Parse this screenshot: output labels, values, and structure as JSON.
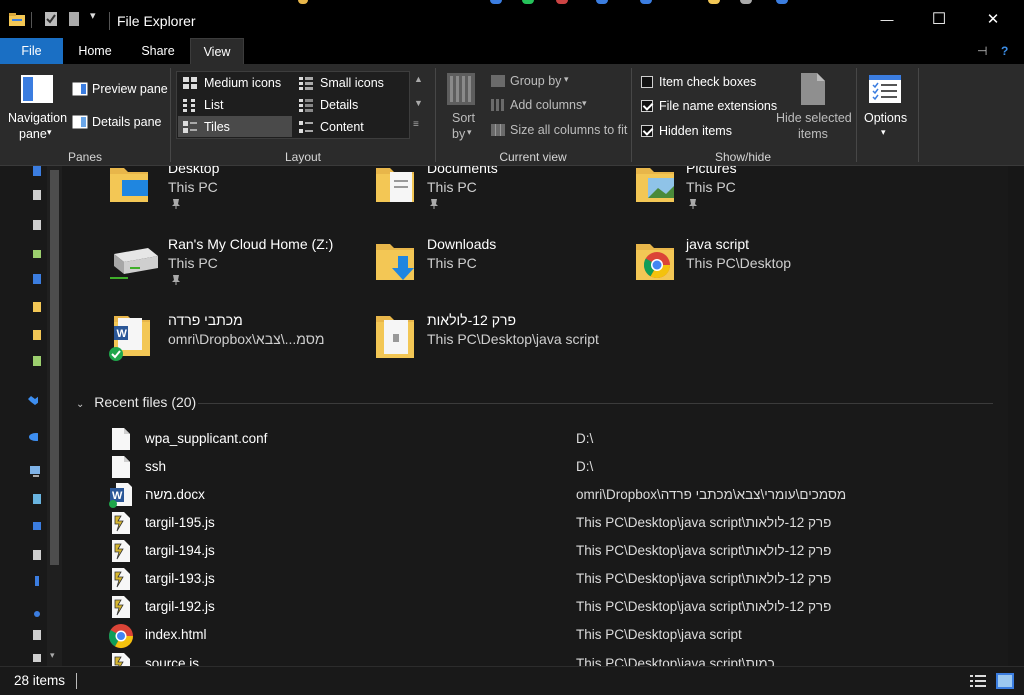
{
  "window": {
    "title": "File Explorer",
    "controls": {
      "minimize": "—",
      "maximize": "☐",
      "close": "✕"
    }
  },
  "tabs": [
    {
      "label": "File"
    },
    {
      "label": "Home"
    },
    {
      "label": "Share"
    },
    {
      "label": "View"
    }
  ],
  "ribbon": {
    "panes": {
      "group_label": "Panes",
      "navigation_pane": "Navigation",
      "navigation_pane_line2": "pane",
      "preview_pane": "Preview pane",
      "details_pane": "Details pane"
    },
    "layout": {
      "group_label": "Layout",
      "items": [
        {
          "label": "Medium icons",
          "selected": false
        },
        {
          "label": "Small icons",
          "selected": false
        },
        {
          "label": "List",
          "selected": false
        },
        {
          "label": "Details",
          "selected": false
        },
        {
          "label": "Tiles",
          "selected": true
        },
        {
          "label": "Content",
          "selected": false
        }
      ]
    },
    "current_view": {
      "group_label": "Current view",
      "sort_by": "Sort",
      "sort_by_line2": "by",
      "group_by": "Group by",
      "add_columns": "Add columns",
      "size_all_columns": "Size all columns to fit"
    },
    "show_hide": {
      "group_label": "Show/hide",
      "item_check_boxes": {
        "label": "Item check boxes",
        "checked": false
      },
      "file_name_extensions": {
        "label": "File name extensions",
        "checked": true
      },
      "hidden_items": {
        "label": "Hidden items",
        "checked": true
      },
      "hide_selected": "Hide selected",
      "hide_selected_line2": "items"
    },
    "options": {
      "label": "Options"
    }
  },
  "quick_access": [
    {
      "name": "Desktop",
      "location": "This PC",
      "icon": "desktop-folder-icon",
      "pinned": true
    },
    {
      "name": "Documents",
      "location": "This PC",
      "icon": "documents-folder-icon",
      "pinned": true
    },
    {
      "name": "Pictures",
      "location": "This PC",
      "icon": "pictures-folder-icon",
      "pinned": true
    },
    {
      "name": "Ran's My Cloud Home (Z:)",
      "location": "This PC",
      "icon": "network-drive-icon",
      "pinned": true
    },
    {
      "name": "Downloads",
      "location": "This PC",
      "icon": "downloads-folder-icon",
      "pinned": false
    },
    {
      "name": "java script",
      "location": "This PC\\Desktop",
      "icon": "chrome-folder-icon",
      "pinned": false
    },
    {
      "name": "מכתבי פרדה",
      "location": "omri\\Dropbox\\מסמ...\\צבא",
      "icon": "word-folder-icon",
      "pinned": false
    },
    {
      "name": "פרק 12-לולאות",
      "location": "This PC\\Desktop\\java script",
      "icon": "folder-icon",
      "pinned": false
    }
  ],
  "recent": {
    "header": "Recent files (20)",
    "files": [
      {
        "name": "wpa_supplicant.conf",
        "path": "D:\\",
        "icon": "file-icon"
      },
      {
        "name": "ssh",
        "path": "D:\\",
        "icon": "file-icon"
      },
      {
        "name": "משה.docx",
        "path": "omri\\Dropbox\\מסמכים\\עומרי\\צבא\\מכתבי פרדה",
        "icon": "word-icon"
      },
      {
        "name": "targil-195.js",
        "path": "This PC\\Desktop\\java script\\פרק 12-לולאות",
        "icon": "js-icon"
      },
      {
        "name": "targil-194.js",
        "path": "This PC\\Desktop\\java script\\פרק 12-לולאות",
        "icon": "js-icon"
      },
      {
        "name": "targil-193.js",
        "path": "This PC\\Desktop\\java script\\פרק 12-לולאות",
        "icon": "js-icon"
      },
      {
        "name": "targil-192.js",
        "path": "This PC\\Desktop\\java script\\פרק 12-לולאות",
        "icon": "js-icon"
      },
      {
        "name": "index.html",
        "path": "This PC\\Desktop\\java script",
        "icon": "chrome-icon"
      },
      {
        "name": "source.js",
        "path": "This PC\\Desktop\\java script\\כמות",
        "icon": "js-icon"
      }
    ]
  },
  "status": {
    "item_count": "28 items"
  },
  "colors": {
    "accent": "#1a6fc4",
    "background": "#191919",
    "ribbon": "#2b2b2b",
    "folder": "#f3c755"
  }
}
